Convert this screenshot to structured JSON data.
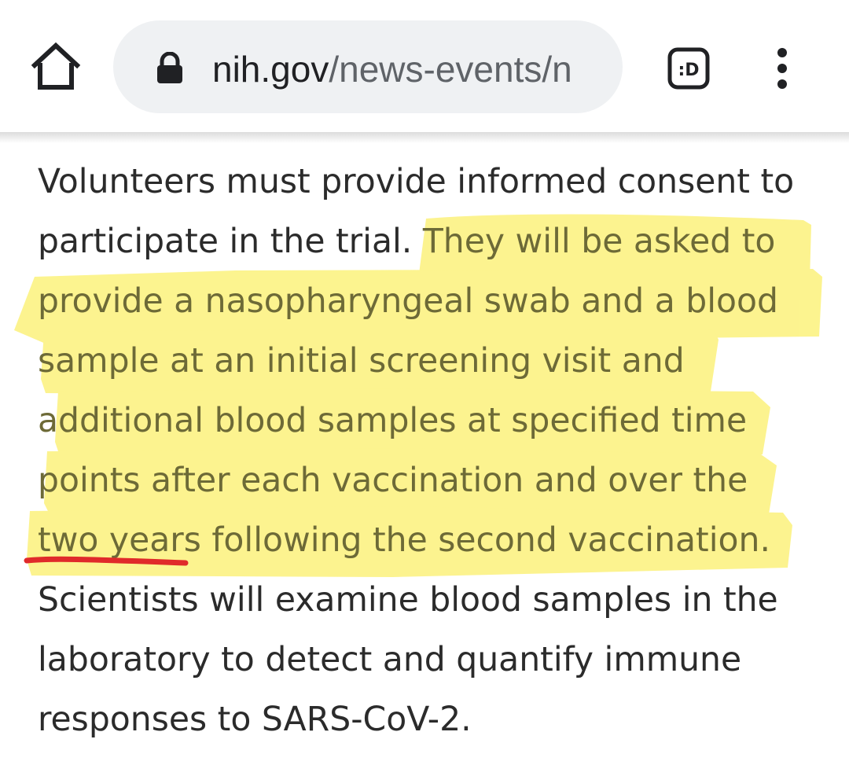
{
  "browser": {
    "url_domain": "nih.gov",
    "url_path": "/news-events/n",
    "extension_icon_label": ":D",
    "icons": [
      "home-icon",
      "lock-icon",
      "extension-icon",
      "more-vert-icon"
    ]
  },
  "article": {
    "line1": "Volunteers must provide informed consent to",
    "line2_plain": "participate in the trial. ",
    "line2_marked": "They will be asked to",
    "line3": "provide a nasopharyngeal swab and a blood",
    "line4": "sample at an initial screening visit and",
    "line5": "additional blood samples at specified time",
    "line6": "points after each vaccination and over the",
    "line7_underlined": "two years",
    "line7_rest": " following the second vaccination.",
    "line8": "Scientists will examine blood samples in the",
    "line9": "laboratory to detect and quantify immune",
    "line10": "responses to SARS-CoV-2."
  },
  "annotations": {
    "highlight_color": "#fbf06a",
    "underline_color": "#e02a2a"
  }
}
